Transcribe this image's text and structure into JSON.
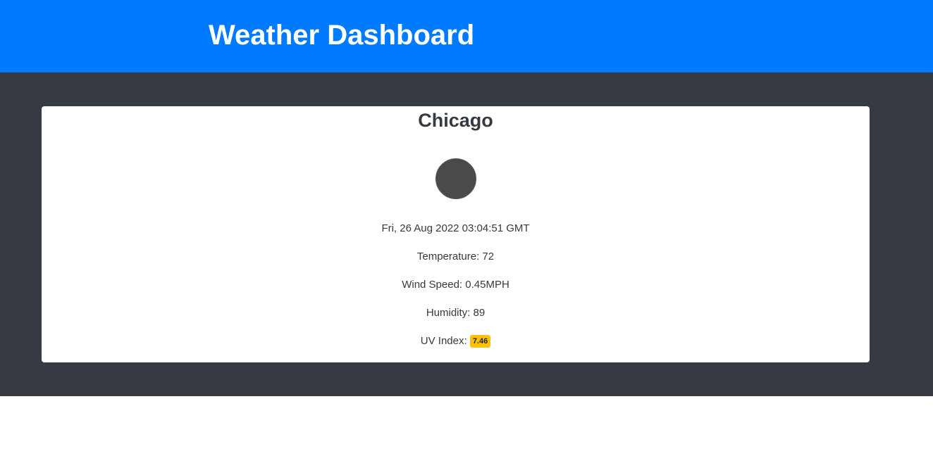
{
  "header": {
    "title": "Weather Dashboard"
  },
  "card": {
    "city": "Chicago",
    "icon": "weather-condition-icon",
    "date": "Fri, 26 Aug 2022 03:04:51 GMT",
    "temperature": "Temperature: 72",
    "wind_speed": "Wind Speed: 0.45MPH",
    "humidity": "Humidity: 89",
    "uv_label": "UV Index:",
    "uv_value": "7.46"
  },
  "colors": {
    "header": "#007bff",
    "main_background": "#363a43",
    "uv_badge": "#ffc107"
  }
}
